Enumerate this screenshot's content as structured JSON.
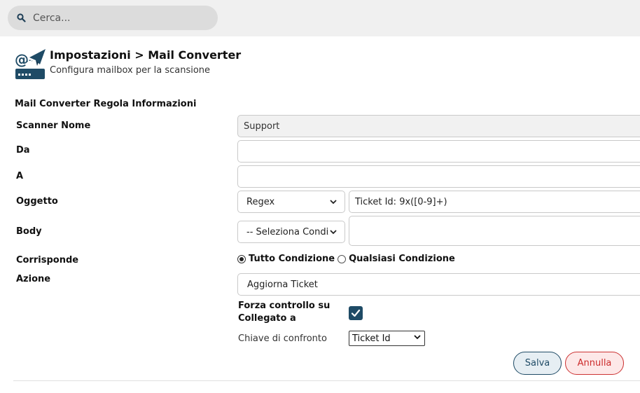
{
  "search": {
    "placeholder": "Cerca..."
  },
  "header": {
    "title": "Impostazioni > Mail Converter",
    "subtitle": "Configura mailbox per la scansione"
  },
  "form": {
    "section_title": "Mail Converter Regola Informazioni",
    "scanner_name": {
      "label": "Scanner Nome",
      "value": "Support"
    },
    "da": {
      "label": "Da",
      "value": ""
    },
    "a": {
      "label": "A",
      "value": ""
    },
    "oggetto": {
      "label": "Oggetto",
      "operator": "Regex",
      "value": "Ticket Id: 9x([0-9]+)"
    },
    "body": {
      "label": "Body",
      "operator": "-- Seleziona Condiz",
      "value": ""
    },
    "corrisponde": {
      "label": "Corrisponde",
      "options": [
        "Tutto Condizione",
        "Qualsiasi Condizione"
      ],
      "selected": "Tutto Condizione"
    },
    "azione": {
      "label": "Azione",
      "value": "Aggiorna Ticket"
    },
    "forza": {
      "label": "Forza controllo su Collegato a",
      "checked": true
    },
    "chiave": {
      "label": "Chiave di confronto",
      "value": "Ticket Id"
    }
  },
  "buttons": {
    "save": "Salva",
    "cancel": "Annulla"
  },
  "colors": {
    "accent": "#1f4b66",
    "danger": "#cc2b2b",
    "topbar": "#f0f0f0"
  }
}
